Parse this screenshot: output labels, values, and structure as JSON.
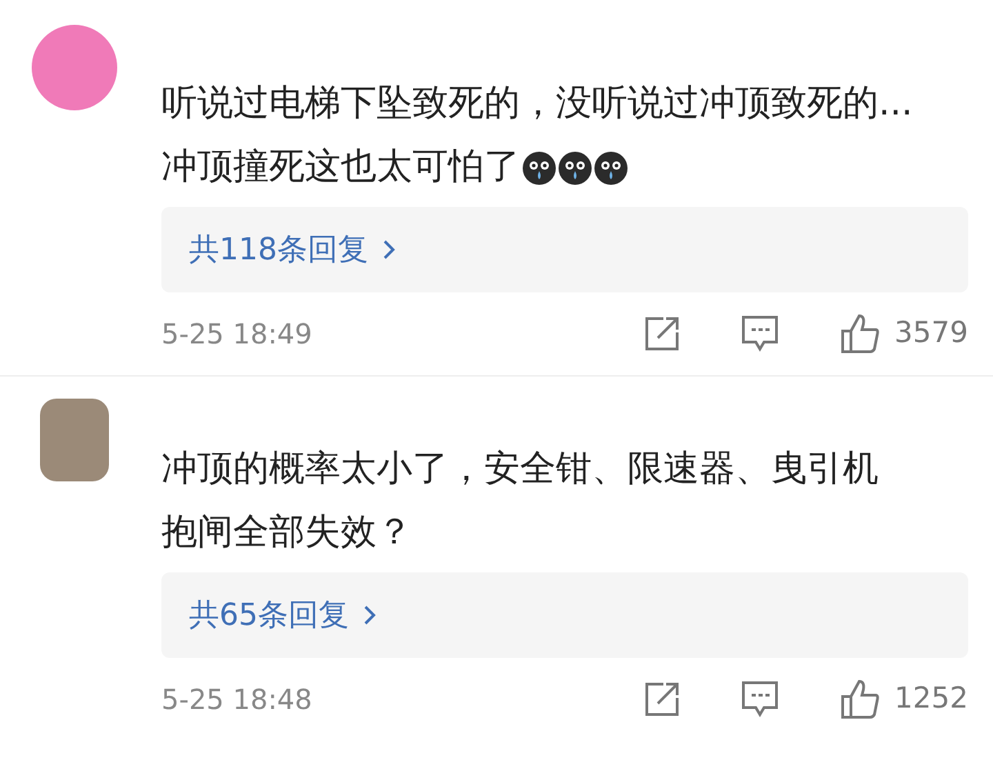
{
  "comments": [
    {
      "lines": [
        "听说过电梯下坠致死的，没听说过冲顶致死的...",
        "冲顶撞死这也太可怕了"
      ],
      "emojis": [
        {
          "kind": "crying"
        },
        {
          "kind": "crying"
        },
        {
          "kind": "crying"
        }
      ],
      "replies": "共118条回复",
      "time": "5-25 18:49",
      "likes": "3579"
    },
    {
      "lines": [
        "冲顶的概率太小了，安全钳、限速器、曳引机",
        "抱闸全部失效？"
      ],
      "replies": "共65条回复",
      "time": "5-25 18:48",
      "likes": "1252"
    }
  ]
}
